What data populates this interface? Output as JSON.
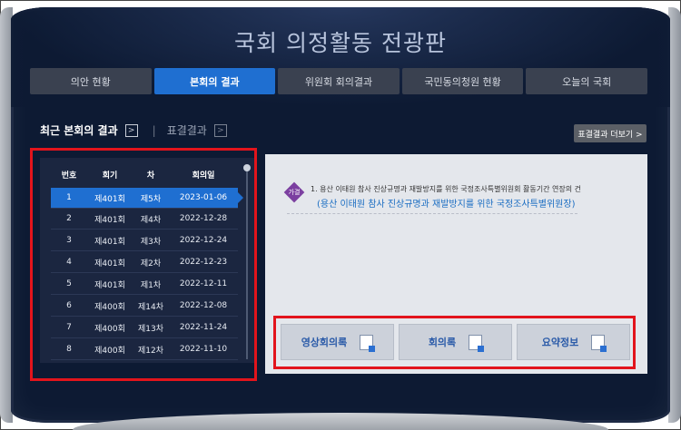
{
  "title": "국회 의정활동 전광판",
  "tabs": [
    "의안 현황",
    "본회의 결과",
    "위원회 회의결과",
    "국민동의청원 현황",
    "오늘의 국회"
  ],
  "active_tab": 1,
  "sub_nav": {
    "primary": "최근 본회의 결과",
    "secondary": "표결결과"
  },
  "more_button": "표결결과 더보기 >",
  "table": {
    "headers": [
      "번호",
      "회기",
      "차",
      "회의일"
    ],
    "rows": [
      [
        "1",
        "제401회",
        "제5차",
        "2023-01-06"
      ],
      [
        "2",
        "제401회",
        "제4차",
        "2022-12-28"
      ],
      [
        "3",
        "제401회",
        "제3차",
        "2022-12-24"
      ],
      [
        "4",
        "제401회",
        "제2차",
        "2022-12-23"
      ],
      [
        "5",
        "제401회",
        "제1차",
        "2022-12-11"
      ],
      [
        "6",
        "제400회",
        "제14차",
        "2022-12-08"
      ],
      [
        "7",
        "제400회",
        "제13차",
        "2022-11-24"
      ],
      [
        "8",
        "제400회",
        "제12차",
        "2022-11-10"
      ]
    ]
  },
  "agenda": {
    "badge": "가결",
    "item": "1. 용산 이태원 참사 진상규명과 재발방지를 위한 국정조사특별위원회 활동기간 연장의 건",
    "sub": "(용산 이태원 참사 진상규명과 재발방지를 위한 국정조사특별위원장)"
  },
  "buttons": [
    "영상회의록",
    "회의록",
    "요약정보"
  ]
}
